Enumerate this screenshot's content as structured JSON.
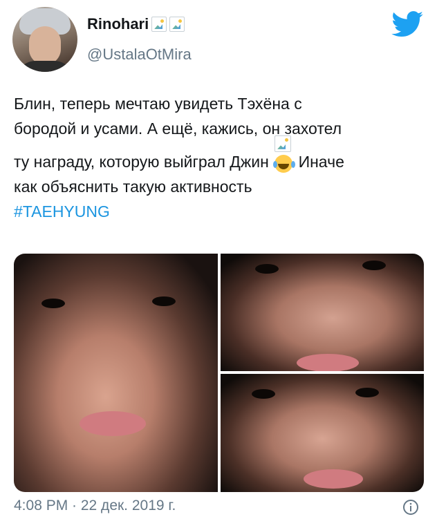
{
  "tweet": {
    "display_name": "Rinohari",
    "handle": "@UstalaOtMira",
    "text_lines": [
      "Блин, теперь мечтаю увидеть Тэхёна с",
      "бородой и усами. А ещё, кажись, он захотел",
      "ту награду, которую выйграл Джин",
      "Иначе",
      "как объяснить такую активность"
    ],
    "hashtag": "#TAEHYUNG",
    "timestamp": "4:08 PM · 22 дек. 2019 г."
  },
  "icons": {
    "platform": "twitter-bird-icon",
    "emoji": "tears-of-joy-emoji",
    "info": "info-icon"
  },
  "colors": {
    "accent": "#1da1f2",
    "hashtag": "#1b95e0",
    "secondary_text": "#657786",
    "primary_text": "#14171a"
  }
}
